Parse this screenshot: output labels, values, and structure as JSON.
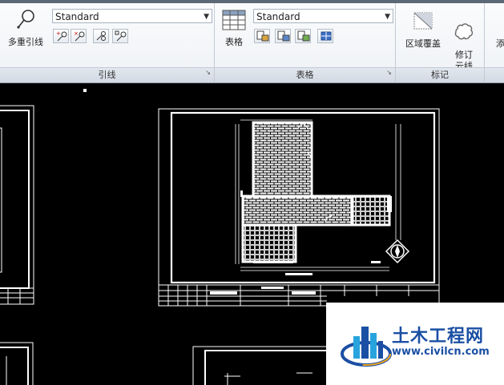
{
  "ribbon": {
    "multileader_label": "多重引线",
    "leader_style": "Standard",
    "leader_panel_label": "引线",
    "table_label": "表格",
    "table_style": "Standard",
    "table_panel_label": "表格",
    "wipeout_label": "区域覆盖",
    "revcloud_label": "修订\n云线",
    "markup_panel_label": "标记",
    "add_label_partial": "添"
  },
  "watermark": {
    "site_name": "土木工程网",
    "url": "www.civilcn.com"
  }
}
